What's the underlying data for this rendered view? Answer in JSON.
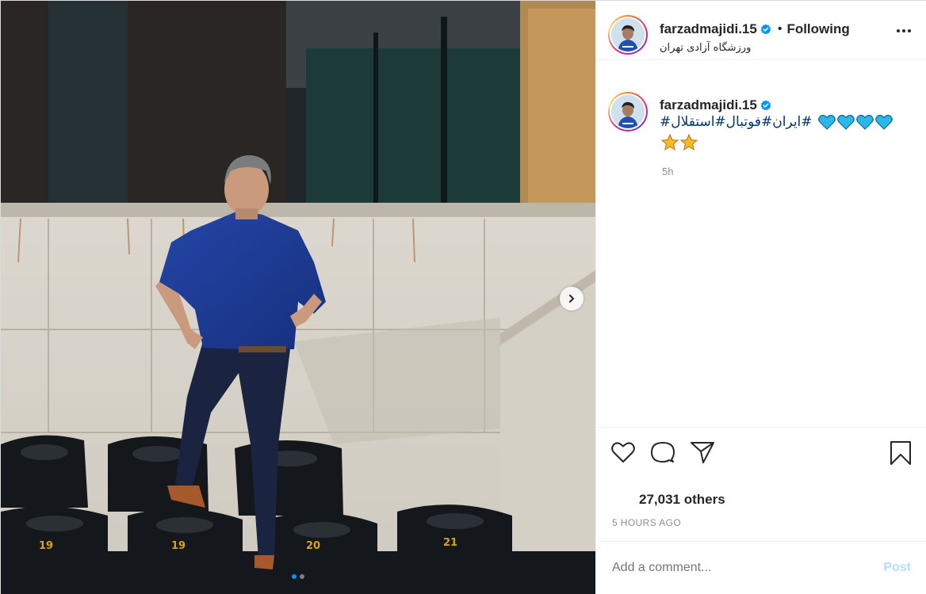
{
  "post": {
    "username": "farzadmajidi.15",
    "verified": true,
    "follow_state": "Following",
    "location": "ورزشگاه آزادی تهران",
    "separator": "•"
  },
  "photo": {
    "seat_numbers": [
      "19",
      "19",
      "20",
      "21"
    ],
    "carousel_dots": 2,
    "active_dot": 0
  },
  "caption": {
    "username": "farzadmajidi.15",
    "text": "#ایران#فوتبال#استقلال#",
    "hearts": [
      "blue-heart",
      "blue-heart",
      "blue-heart",
      "blue-heart"
    ],
    "stars": [
      "star",
      "star"
    ],
    "time": "5h"
  },
  "actions": {
    "icons": [
      "heart-icon",
      "comment-icon",
      "share-icon",
      "bookmark-icon"
    ]
  },
  "likes": {
    "text": "27,031 others"
  },
  "posted_ago": "5 HOURS AGO",
  "comment": {
    "placeholder": "Add a comment...",
    "post_label": "Post"
  },
  "colors": {
    "link": "#00376b",
    "verified": "#0095f6",
    "post_disabled": "#b2dffc",
    "secondary_text": "#8e8e8e",
    "heart": "#2ab7ea"
  }
}
